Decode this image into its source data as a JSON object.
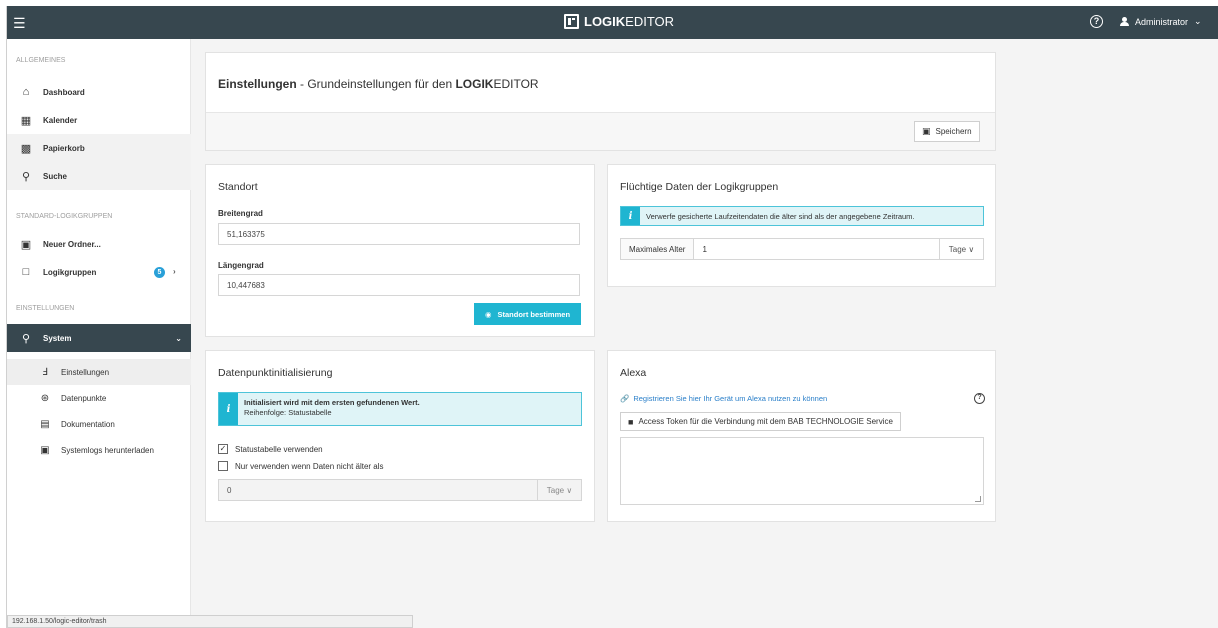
{
  "app": {
    "brand_bold": "LOGIK",
    "brand_rest": "EDITOR",
    "user": "Administrator"
  },
  "icons": {
    "menu": "hamburger-icon",
    "help": "help-icon",
    "user": "user-icon"
  },
  "sidebar": {
    "sections": {
      "general": "ALLGEMEINES",
      "standard": "STANDARD-LOGIKGRUPPEN",
      "settings": "EINSTELLUNGEN"
    },
    "items": [
      {
        "label": "Dashboard",
        "icon": "home-icon"
      },
      {
        "label": "Kalender",
        "icon": "calendar-icon"
      },
      {
        "label": "Papierkorb",
        "icon": "trash-icon"
      },
      {
        "label": "Suche",
        "icon": "search-icon"
      },
      {
        "label": "Neuer Ordner...",
        "icon": "inbox-icon"
      },
      {
        "label": "Logikgruppen",
        "icon": "folder-icon",
        "badge": "5"
      },
      {
        "label": "System",
        "icon": "key-icon"
      }
    ],
    "subitems": [
      {
        "label": "Einstellungen",
        "icon": "wrench-icon"
      },
      {
        "label": "Datenpunkte",
        "icon": "network-icon"
      },
      {
        "label": "Dokumentation",
        "icon": "book-icon"
      },
      {
        "label": "Systemlogs herunterladen",
        "icon": "download-icon"
      }
    ]
  },
  "status_url": "192.168.1.50/logic-editor/trash",
  "header": {
    "title_bold": "Einstellungen",
    "title_rest": " - Grundeinstellungen für den ",
    "title_brand_bold": "LOGIK",
    "title_brand_rest": "EDITOR",
    "save_label": "Speichern"
  },
  "standort": {
    "title": "Standort",
    "lat_label": "Breitengrad",
    "lat_value": "51,163375",
    "lon_label": "Längengrad",
    "lon_value": "10,447683",
    "locate_button": "Standort bestimmen"
  },
  "volatile": {
    "title": "Flüchtige Daten der Logikgruppen",
    "info": "Verwerfe gesicherte Laufzeitendaten die älter sind als der angegebene Zeitraum.",
    "max_age_label": "Maximales Alter",
    "max_age_value": "1",
    "unit": "Tage ∨"
  },
  "init": {
    "title": "Datenpunktinitialisierung",
    "info_bold": "Initialisiert wird mit dem ersten gefundenen Wert.",
    "info_sub": "Reihenfolge: Statustabelle",
    "chk1_label": "Statustabelle verwenden",
    "chk1_checked": true,
    "chk2_label": "Nur verwenden wenn Daten nicht älter als",
    "chk2_checked": false,
    "age_value": "0",
    "unit": "Tage ∨"
  },
  "alexa": {
    "title": "Alexa",
    "register_link": "Registrieren Sie hier Ihr Gerät um Alexa nutzen zu können",
    "token_button": "Access Token für die Verbindung mit dem BAB TECHNOLOGIE Service"
  }
}
